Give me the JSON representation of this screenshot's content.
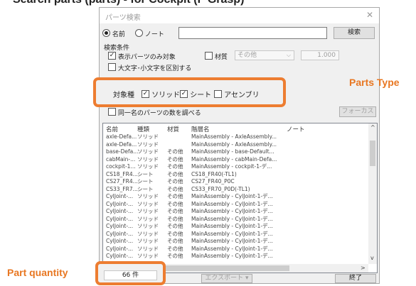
{
  "top_caption": "Search parts (parts) - for Cockpit (F Grasp)",
  "dialog": {
    "title": "パーツ検索",
    "close_icon": "close-icon"
  },
  "search": {
    "radio_name": "名前",
    "radio_note": "ノート",
    "search_button": "検索"
  },
  "conditions": {
    "group_label": "検索条件",
    "visible_only": "表示パーツのみ対象",
    "material_label": "材質",
    "material_value": "その他",
    "material_number": "1.000",
    "case_sensitive": "大文字･小文字を区別する"
  },
  "object_type": {
    "label": "対象種",
    "solid": "ソリッド",
    "sheet": "シート",
    "assembly": "アセンブリ"
  },
  "same_name_count": "同一名のパーツの数を調べる",
  "focus_button": "フォーカス",
  "annotations": {
    "parts_type": "Parts Type",
    "part_quantity": "Part quantity"
  },
  "table": {
    "columns": [
      "名前",
      "種類",
      "材質",
      "階層名",
      "ノート"
    ],
    "rows": [
      [
        "axle-Defa...",
        "ソリッド",
        "",
        "MainAssembly - AxleAssembly..."
      ],
      [
        "axle-Defa...",
        "ソリッド",
        "",
        "MainAssembly - AxleAssembly..."
      ],
      [
        "base-Defa...",
        "ソリッド",
        "その他",
        "MainAssembly - base-Default..."
      ],
      [
        "cabMain-...",
        "ソリッド",
        "その他",
        "MainAssembly - cabMain-Defa..."
      ],
      [
        "cockpit-1...",
        "ソリッド",
        "その他",
        "MainAssembly - cockpit-1-デ..."
      ],
      [
        "CS18_FR4...",
        "シート",
        "その他",
        "CS18_FR40(-TL1)"
      ],
      [
        "CS27_FR4...",
        "シート",
        "その他",
        "CS27_FR40_P0C"
      ],
      [
        "CS33_FR7...",
        "シート",
        "その他",
        "CS33_FR70_P0D(-TL1)"
      ],
      [
        "CylJoint-...",
        "ソリッド",
        "その他",
        "MainAssembly - CylJoint-1-デ..."
      ],
      [
        "CylJoint-...",
        "ソリッド",
        "その他",
        "MainAssembly - CylJoint-1-デ..."
      ],
      [
        "CylJoint-...",
        "ソリッド",
        "その他",
        "MainAssembly - CylJoint-1-デ..."
      ],
      [
        "CylJoint-...",
        "ソリッド",
        "その他",
        "MainAssembly - CylJoint-1-デ..."
      ],
      [
        "CylJoint-...",
        "ソリッド",
        "その他",
        "MainAssembly - CylJoint-1-デ..."
      ],
      [
        "CylJoint-...",
        "ソリッド",
        "その他",
        "MainAssembly - CylJoint-1-デ..."
      ],
      [
        "CylJoint-...",
        "ソリッド",
        "その他",
        "MainAssembly - CylJoint-1-デ..."
      ],
      [
        "CylJoint-...",
        "ソリッド",
        "その他",
        "MainAssembly - CylJoint-1-デ..."
      ],
      [
        "CylJoint-...",
        "ソリッド",
        "その他",
        "MainAssembly - CylJoint-1-デ..."
      ]
    ]
  },
  "footer": {
    "count": "66 件",
    "export_button": "エクスポート",
    "close_button": "終了"
  },
  "colors": {
    "highlight": "#ed7d31",
    "annotation_text": "#e87722"
  }
}
